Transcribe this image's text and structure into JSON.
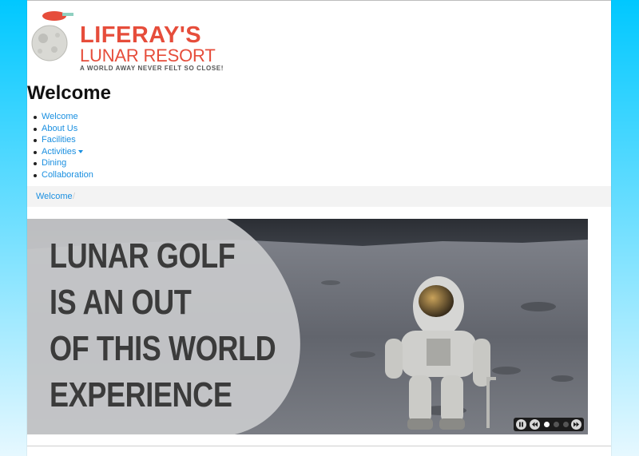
{
  "logo": {
    "title": "LIFERAY'S",
    "subtitle": "LUNAR RESORT",
    "tagline": "A WORLD AWAY NEVER FELT SO CLOSE!"
  },
  "page_title": "Welcome",
  "nav": {
    "items": [
      {
        "label": "Welcome"
      },
      {
        "label": "About Us"
      },
      {
        "label": "Facilities"
      },
      {
        "label": "Activities",
        "has_dropdown": true
      },
      {
        "label": "Dining"
      },
      {
        "label": "Collaboration"
      }
    ]
  },
  "breadcrumb": {
    "current": "Welcome",
    "separator": "/"
  },
  "carousel": {
    "slide_lines": [
      "LUNAR GOLF",
      "IS AN OUT",
      "OF THIS WORLD",
      "EXPERIENCE"
    ],
    "active_slide": 1,
    "slide_count": 3,
    "controls": [
      "pause-icon",
      "rewind-icon",
      "fast-forward-icon"
    ]
  },
  "colors": {
    "brand_red": "#e64d3b",
    "link_blue": "#1a8fe0",
    "background_cyan": "#00c8ff"
  }
}
